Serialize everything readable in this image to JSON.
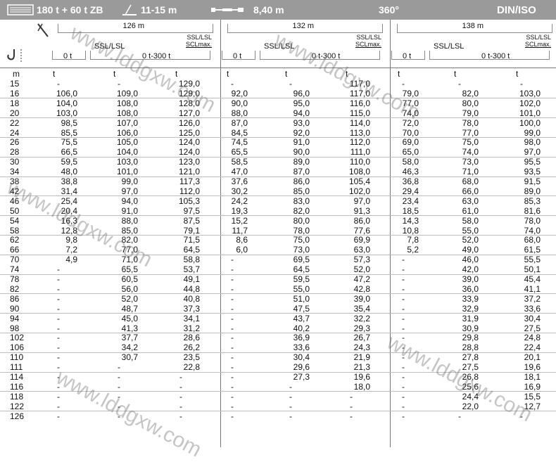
{
  "header": {
    "capacity": "180 t + 60 t ZB",
    "range": "11-15 m",
    "width": "8,40 m",
    "slew": "360°",
    "standard": "DIN/ISO"
  },
  "groups": [
    {
      "boom": "126 m",
      "mode": "SSL/LSL",
      "sub": "SSL/LSL SCLmax.",
      "ballast1": "0 t",
      "ballast2": "0 t-300 t"
    },
    {
      "boom": "132 m",
      "mode": "SSL/LSL",
      "sub": "SSL/LSL SCLmax.",
      "ballast1": "0 t",
      "ballast2": "0 t-300 t"
    },
    {
      "boom": "138 m",
      "mode": "SSL/LSL",
      "sub": "SSL/LSL SCLmax.",
      "ballast1": "0 t",
      "ballast2": "0 t-300 t"
    }
  ],
  "units": [
    "m",
    "t",
    "t",
    "t",
    "t",
    "t",
    "t",
    "t",
    "t",
    "t"
  ],
  "rows": [
    [
      "15",
      "-",
      "-",
      "129,0",
      "-",
      "-",
      "117,0",
      "-",
      "-",
      "-"
    ],
    [
      "16",
      "106,0",
      "109,0",
      "129,0",
      "92,0",
      "96,0",
      "117,0",
      "79,0",
      "82,0",
      "103,0"
    ],
    [
      "18",
      "104,0",
      "108,0",
      "128,0",
      "90,0",
      "95,0",
      "116,0",
      "77,0",
      "80,0",
      "102,0"
    ],
    [
      "20",
      "103,0",
      "108,0",
      "127,0",
      "88,0",
      "94,0",
      "115,0",
      "74,0",
      "79,0",
      "101,0"
    ],
    [
      "22",
      "98,5",
      "107,0",
      "126,0",
      "87,0",
      "93,0",
      "114,0",
      "72,0",
      "78,0",
      "100,0"
    ],
    [
      "24",
      "85,5",
      "106,0",
      "125,0",
      "84,5",
      "92,0",
      "113,0",
      "70,0",
      "77,0",
      "99,0"
    ],
    [
      "26",
      "75,5",
      "105,0",
      "124,0",
      "74,5",
      "91,0",
      "112,0",
      "69,0",
      "75,0",
      "98,0"
    ],
    [
      "28",
      "66,5",
      "104,0",
      "124,0",
      "65,5",
      "90,0",
      "111,0",
      "65,0",
      "74,0",
      "97,0"
    ],
    [
      "30",
      "59,5",
      "103,0",
      "123,0",
      "58,5",
      "89,0",
      "110,0",
      "58,0",
      "73,0",
      "95,5"
    ],
    [
      "34",
      "48,0",
      "101,0",
      "121,0",
      "47,0",
      "87,0",
      "108,0",
      "46,3",
      "71,0",
      "93,5"
    ],
    [
      "38",
      "38,8",
      "99,0",
      "117,3",
      "37,6",
      "86,0",
      "105,4",
      "36,8",
      "68,0",
      "91,5"
    ],
    [
      "42",
      "31,4",
      "97,0",
      "112,0",
      "30,2",
      "85,0",
      "102,0",
      "29,4",
      "66,0",
      "89,0"
    ],
    [
      "46",
      "25,4",
      "94,0",
      "105,3",
      "24,2",
      "83,0",
      "97,0",
      "23,4",
      "63,0",
      "85,3"
    ],
    [
      "50",
      "20,4",
      "91,0",
      "97,5",
      "19,3",
      "82,0",
      "91,3",
      "18,5",
      "61,0",
      "81,6"
    ],
    [
      "54",
      "16,3",
      "88,0",
      "87,5",
      "15,2",
      "80,0",
      "86,0",
      "14,3",
      "58,0",
      "78,0"
    ],
    [
      "58",
      "12,8",
      "85,0",
      "79,1",
      "11,7",
      "78,0",
      "77,6",
      "10,8",
      "55,0",
      "74,0"
    ],
    [
      "62",
      "9,8",
      "82,0",
      "71,5",
      "8,6",
      "75,0",
      "69,9",
      "7,8",
      "52,0",
      "68,0"
    ],
    [
      "66",
      "7,2",
      "77,0",
      "64,5",
      "6,0",
      "73,0",
      "63,0",
      "5,2",
      "49,0",
      "61,5"
    ],
    [
      "70",
      "4,9",
      "71,0",
      "58,8",
      "-",
      "69,5",
      "57,3",
      "-",
      "46,0",
      "55,5"
    ],
    [
      "74",
      "-",
      "65,5",
      "53,7",
      "-",
      "64,5",
      "52,0",
      "-",
      "42,0",
      "50,1"
    ],
    [
      "78",
      "-",
      "60,5",
      "49,1",
      "-",
      "59,5",
      "47,2",
      "-",
      "39,0",
      "45,4"
    ],
    [
      "82",
      "-",
      "56,0",
      "44,8",
      "-",
      "55,0",
      "42,8",
      "-",
      "36,0",
      "41,1"
    ],
    [
      "86",
      "-",
      "52,0",
      "40,8",
      "-",
      "51,0",
      "39,0",
      "-",
      "33,9",
      "37,2"
    ],
    [
      "90",
      "-",
      "48,7",
      "37,3",
      "-",
      "47,5",
      "35,4",
      "-",
      "32,9",
      "33,6"
    ],
    [
      "94",
      "-",
      "45,0",
      "34,1",
      "-",
      "43,7",
      "32,2",
      "-",
      "31,9",
      "30,4"
    ],
    [
      "98",
      "-",
      "41,3",
      "31,2",
      "-",
      "40,2",
      "29,3",
      "-",
      "30,9",
      "27,5"
    ],
    [
      "102",
      "-",
      "37,7",
      "28,6",
      "-",
      "36,9",
      "26,7",
      "-",
      "29,8",
      "24,8"
    ],
    [
      "106",
      "-",
      "34,2",
      "26,2",
      "-",
      "33,6",
      "24,3",
      "-",
      "28,8",
      "22,4"
    ],
    [
      "110",
      "-",
      "30,7",
      "23,5",
      "-",
      "30,4",
      "21,9",
      "-",
      "27,8",
      "20,1"
    ],
    [
      "111",
      "-",
      "-",
      "22,8",
      "-",
      "29,6",
      "21,3",
      "-",
      "27,5",
      "19,6"
    ],
    [
      "114",
      "-",
      "-",
      "-",
      "-",
      "27,3",
      "19,6",
      "-",
      "26,8",
      "18,1"
    ],
    [
      "116",
      "-",
      "-",
      "-",
      "-",
      "-",
      "18,0",
      "-",
      "25,6",
      "16,9"
    ],
    [
      "118",
      "-",
      "-",
      "-",
      "-",
      "-",
      "-",
      "-",
      "24,4",
      "15,5"
    ],
    [
      "122",
      "-",
      "-",
      "-",
      "-",
      "-",
      "-",
      "-",
      "22,0",
      "12,7"
    ],
    [
      "126",
      "-",
      "-",
      "-",
      "-",
      "-",
      "-",
      "-",
      "-",
      "-"
    ]
  ],
  "watermark": "www.lddgxw.com"
}
